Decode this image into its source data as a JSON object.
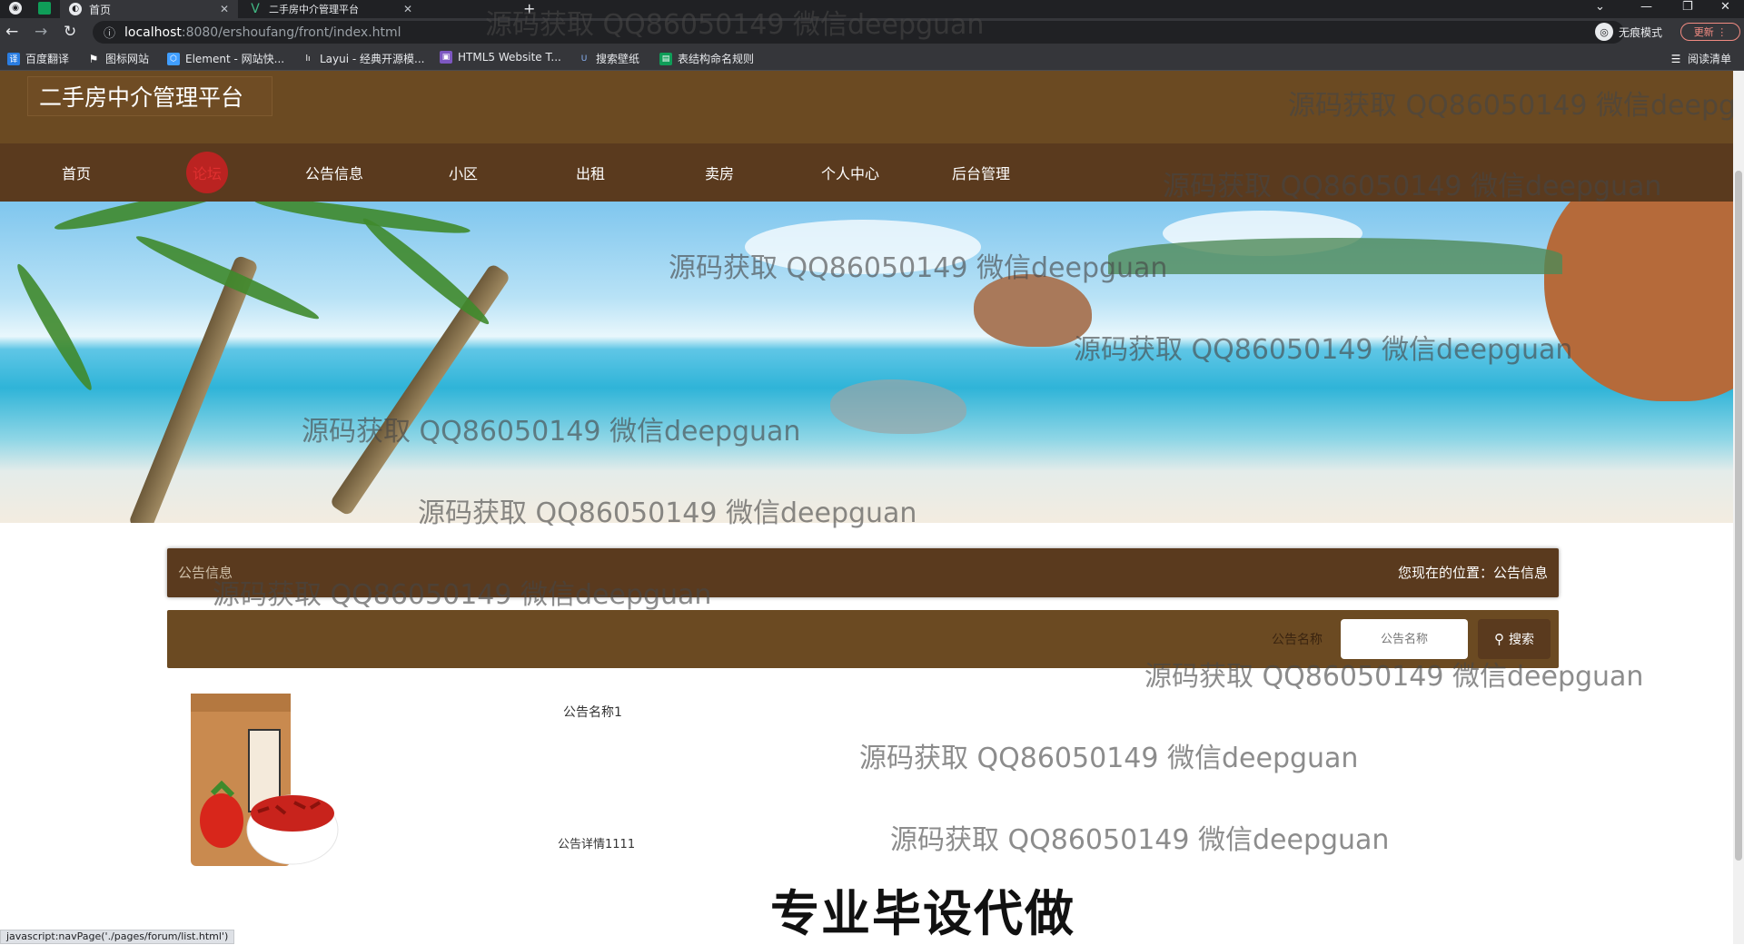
{
  "browser": {
    "tabs": [
      {
        "title": "首页",
        "active": true
      },
      {
        "title": "二手房中介管理平台",
        "active": false
      }
    ],
    "new_tab": "+",
    "url_host": "localhost",
    "url_path": ":8080/ershoufang/front/index.html",
    "incognito_label": "无痕模式",
    "update_label": "更新",
    "reading_list": "阅读清单",
    "bookmarks": [
      {
        "label": "百度翻译",
        "icon": "translate-icon",
        "color": "#2a7de1"
      },
      {
        "label": "图标网站",
        "icon": "flag-icon",
        "color": "#444"
      },
      {
        "label": "Element - 网站快...",
        "icon": "element-icon",
        "color": "#409eff"
      },
      {
        "label": "Layui - 经典开源模...",
        "icon": "layui-icon",
        "color": "#555"
      },
      {
        "label": "HTML5 Website T...",
        "icon": "html5-icon",
        "color": "#7d57c1"
      },
      {
        "label": "搜索壁纸",
        "icon": "wallpaper-icon",
        "color": "#3a6ea5"
      },
      {
        "label": "表结构命名规则",
        "icon": "doc-icon",
        "color": "#0f9d58"
      }
    ]
  },
  "site": {
    "title": "二手房中介管理平台",
    "nav": [
      "首页",
      "论坛",
      "公告信息",
      "小区",
      "出租",
      "卖房",
      "个人中心",
      "后台管理"
    ],
    "hovered_nav": "论坛",
    "breadcrumb_left": "公告信息",
    "breadcrumb_right": "您现在的位置：公告信息",
    "search_label": "公告名称",
    "search_placeholder": "公告名称",
    "search_button": "搜索",
    "carousel_active": 1,
    "items": [
      {
        "title": "公告名称1",
        "detail": "公告详情1111"
      }
    ],
    "brand_color": "#6b4a22",
    "nav_color": "#5a3a1e"
  },
  "watermark": "源码获取 QQ86050149 微信deepguan",
  "overlay_caption": "专业毕设代做",
  "status_url": "javascript:navPage('./pages/forum/list.html')"
}
